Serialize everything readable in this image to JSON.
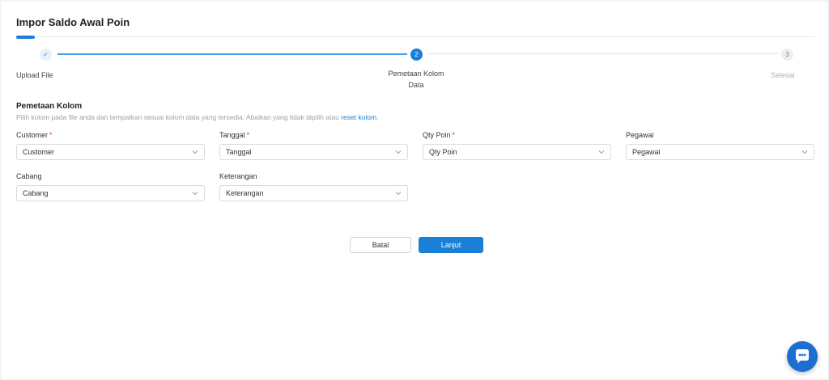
{
  "page": {
    "title": "Impor Saldo Awal Poin"
  },
  "stepper": {
    "steps": [
      {
        "number": "✓",
        "label": "Upload File",
        "state": "done"
      },
      {
        "number": "2",
        "label_line1": "Pemetaan Kolom",
        "label_line2": "Data",
        "state": "active"
      },
      {
        "number": "3",
        "label": "Selesai",
        "state": "pending"
      }
    ]
  },
  "section": {
    "title": "Pemetaan Kolom",
    "description": "Pilih kolom pada file anda dan tempatkan sesuai kolom data yang tersedia. Abaikan yang tidak dipilih atau ",
    "reset_link": "reset kolom",
    "description_end": "."
  },
  "fields": [
    {
      "label": "Customer",
      "required": "*",
      "value": "Customer"
    },
    {
      "label": "Tanggal",
      "required": "*",
      "value": "Tanggal"
    },
    {
      "label": "Qty Poin",
      "required": "*",
      "value": "Qty Poin"
    },
    {
      "label": "Pegawai",
      "required": "",
      "value": "Pegawai"
    },
    {
      "label": "Cabang",
      "required": "",
      "value": "Cabang"
    },
    {
      "label": "Keterangan",
      "required": "",
      "value": "Keterangan"
    }
  ],
  "actions": {
    "cancel_label": "Batal",
    "next_label": "Lanjut"
  },
  "colors": {
    "primary": "#1a7fd6",
    "required": "#e53935",
    "chat": "#1a6fd0"
  },
  "icons": {
    "chevron": "chevron-down-icon",
    "check": "check-icon",
    "chat": "chat-icon"
  }
}
